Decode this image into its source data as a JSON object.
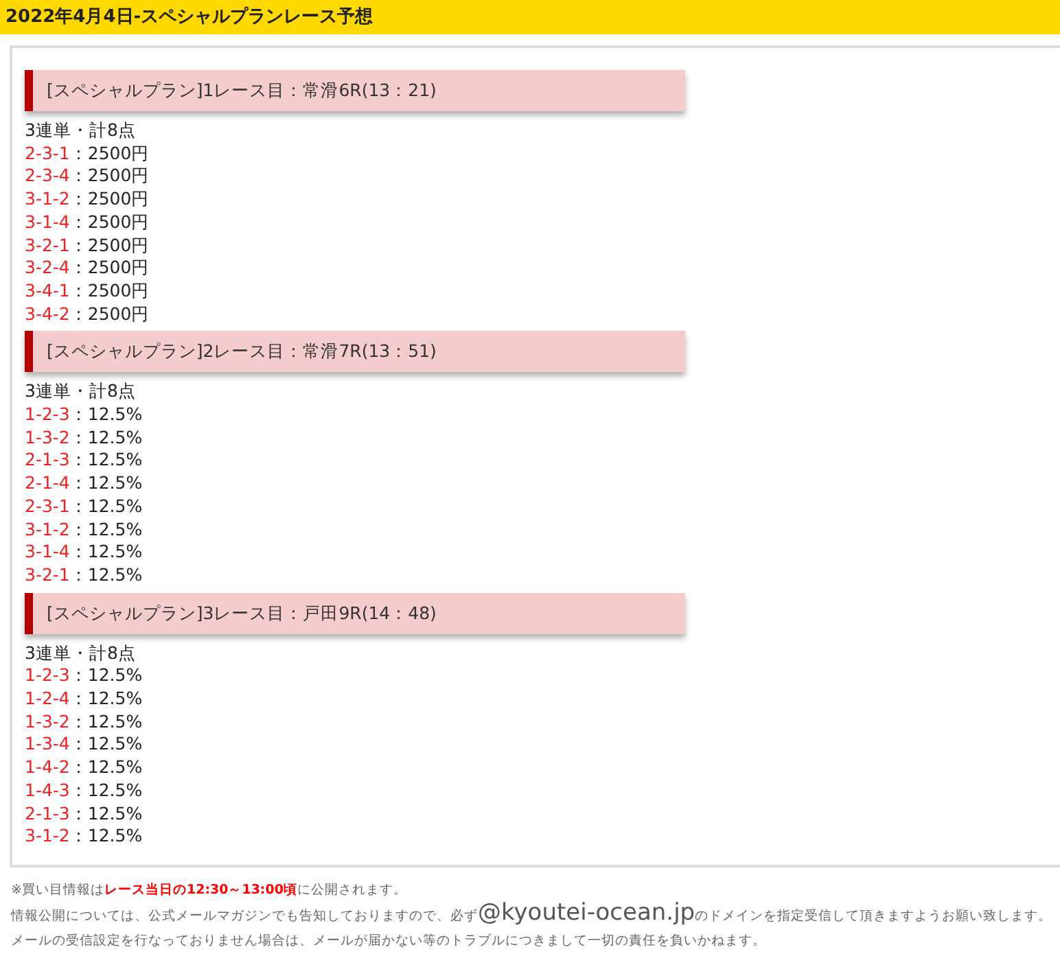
{
  "title": "2022年4月4日-スペシャルプランレース予想",
  "races": [
    {
      "heading": "[スペシャルプラン]1レース目：常滑6R(13：21)",
      "summary": "3連単・計8点",
      "bets": [
        {
          "combo": "2-3-1",
          "amount": "：2500円"
        },
        {
          "combo": "2-3-4",
          "amount": "：2500円"
        },
        {
          "combo": "3-1-2",
          "amount": "：2500円"
        },
        {
          "combo": "3-1-4",
          "amount": "：2500円"
        },
        {
          "combo": "3-2-1",
          "amount": "：2500円"
        },
        {
          "combo": "3-2-4",
          "amount": "：2500円"
        },
        {
          "combo": "3-4-1",
          "amount": "：2500円"
        },
        {
          "combo": "3-4-2",
          "amount": "：2500円"
        }
      ]
    },
    {
      "heading": "[スペシャルプラン]2レース目：常滑7R(13：51)",
      "summary": "3連単・計8点",
      "bets": [
        {
          "combo": "1-2-3",
          "amount": "：12.5%"
        },
        {
          "combo": "1-3-2",
          "amount": "：12.5%"
        },
        {
          "combo": "2-1-3",
          "amount": "：12.5%"
        },
        {
          "combo": "2-1-4",
          "amount": "：12.5%"
        },
        {
          "combo": "2-3-1",
          "amount": "：12.5%"
        },
        {
          "combo": "3-1-2",
          "amount": "：12.5%"
        },
        {
          "combo": "3-1-4",
          "amount": "：12.5%"
        },
        {
          "combo": "3-2-1",
          "amount": "：12.5%"
        }
      ]
    },
    {
      "heading": "[スペシャルプラン]3レース目：戸田9R(14：48)",
      "summary": "3連単・計8点",
      "bets": [
        {
          "combo": "1-2-3",
          "amount": "：12.5%"
        },
        {
          "combo": "1-2-4",
          "amount": "：12.5%"
        },
        {
          "combo": "1-3-2",
          "amount": "：12.5%"
        },
        {
          "combo": "1-3-4",
          "amount": "：12.5%"
        },
        {
          "combo": "1-4-2",
          "amount": "：12.5%"
        },
        {
          "combo": "1-4-3",
          "amount": "：12.5%"
        },
        {
          "combo": "2-1-3",
          "amount": "：12.5%"
        },
        {
          "combo": "3-1-2",
          "amount": "：12.5%"
        }
      ]
    }
  ],
  "footer": {
    "schedule": "※買い目情報は**レース当日の12:30～13:00頃**に公開されます。",
    "domain_notice": {
      "before": "情報公開については、公式メールマガジンでも告知しておりますので、必ず",
      "domain": "@kyoutei-ocean.jp",
      "after": "のドメインを指定受信して頂きますようお願い致します。"
    },
    "disclaimer": "メールの受信設定を行なっておりません場合は、メールが届かない等のトラブルにつきまして一切の責任を負いかねます。"
  }
}
